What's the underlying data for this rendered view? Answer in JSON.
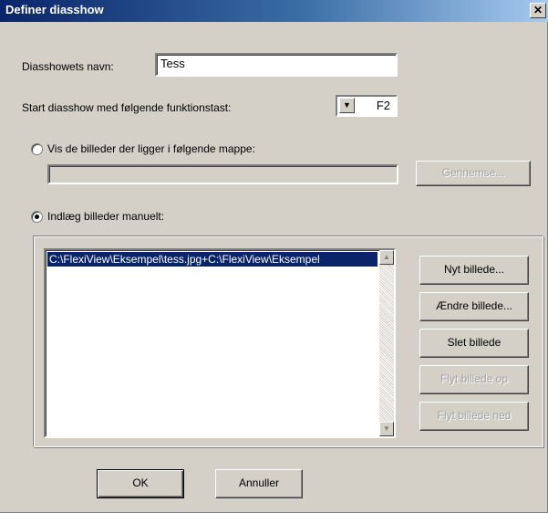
{
  "window": {
    "title": "Definer diasshow",
    "close_symbol": "✕"
  },
  "name_field": {
    "label": "Diasshowets navn:",
    "value": "Tess"
  },
  "function_key": {
    "label": "Start diasshow med følgende funktionstast:",
    "value": "F2",
    "arrow_icon": "chevron-down-icon",
    "arrow_symbol": "▼"
  },
  "folder_option": {
    "label": "Vis de billeder der ligger i følgende mappe:",
    "selected": false,
    "folder_path": "",
    "browse_label": "Gennemse..."
  },
  "manual_option": {
    "label": "Indlæg billeder manuelt:",
    "selected": true
  },
  "image_list": {
    "items": [
      "C:\\FlexiView\\Eksempel\\tess.jpg+C:\\FlexiView\\Eksempel"
    ],
    "scroll_up_symbol": "▲",
    "scroll_down_symbol": "▼"
  },
  "list_buttons": {
    "new": "Nyt billede...",
    "edit": "Ændre billede...",
    "delete": "Slet billede",
    "move_up": "Flyt billede op",
    "move_down": "Flyt billede ned"
  },
  "dialog_buttons": {
    "ok": "OK",
    "cancel": "Annuller"
  }
}
